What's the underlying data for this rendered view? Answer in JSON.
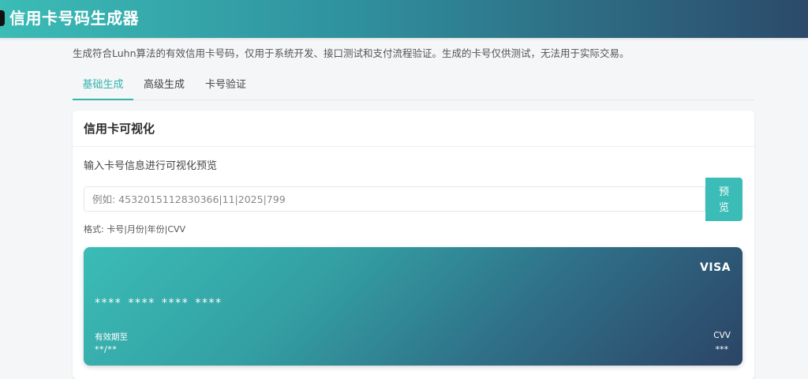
{
  "header": {
    "title": "信用卡号码生成器"
  },
  "description": "生成符合Luhn算法的有效信用卡号码，仅用于系统开发、接口测试和支付流程验证。生成的卡号仅供测试，无法用于实际交易。",
  "tabs": [
    {
      "label": "基础生成",
      "active": true
    },
    {
      "label": "高级生成",
      "active": false
    },
    {
      "label": "卡号验证",
      "active": false
    }
  ],
  "panel": {
    "title": "信用卡可视化",
    "input_label": "输入卡号信息进行可视化预览",
    "input_placeholder": "例如: 4532015112830366|11|2025|799",
    "input_value": "",
    "preview_button": "预览",
    "format_hint": "格式: 卡号|月份|年份|CVV"
  },
  "card": {
    "brand": "VISA",
    "number": "**** **** **** ****",
    "expiry_label": "有效期至",
    "expiry_value": "**/**",
    "cvv_label": "CVV",
    "cvv_value": "***"
  },
  "colors": {
    "accent": "#3bbcb6",
    "header_end": "#2c4a6a",
    "card_start": "#3bbcb6",
    "card_end": "#2c4466"
  }
}
